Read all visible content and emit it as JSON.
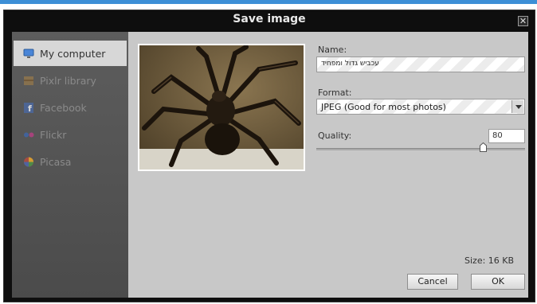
{
  "dialog": {
    "title": "Save image",
    "close_icon": "close-icon"
  },
  "sidebar": {
    "items": [
      {
        "label": "My computer",
        "icon": "computer-icon",
        "active": true
      },
      {
        "label": "Pixlr library",
        "icon": "library-icon",
        "active": false
      },
      {
        "label": "Facebook",
        "icon": "facebook-icon",
        "active": false
      },
      {
        "label": "Flickr",
        "icon": "flickr-icon",
        "active": false
      },
      {
        "label": "Picasa",
        "icon": "picasa-icon",
        "active": false
      }
    ]
  },
  "preview": {
    "description": "tarantula-photo"
  },
  "form": {
    "name_label": "Name:",
    "name_value": "עכביש גדול ומפחיד",
    "format_label": "Format:",
    "format_value": "JPEG (Good for most photos)",
    "quality_label": "Quality:",
    "quality_value": "80",
    "quality_level": 0.8
  },
  "footer": {
    "size_text": "Size: 16 KB",
    "cancel_label": "Cancel",
    "ok_label": "OK"
  },
  "colors": {
    "accent": "#3d8fd6",
    "sidebar_bg": "#565656",
    "panel_bg": "#c8c8c8"
  }
}
